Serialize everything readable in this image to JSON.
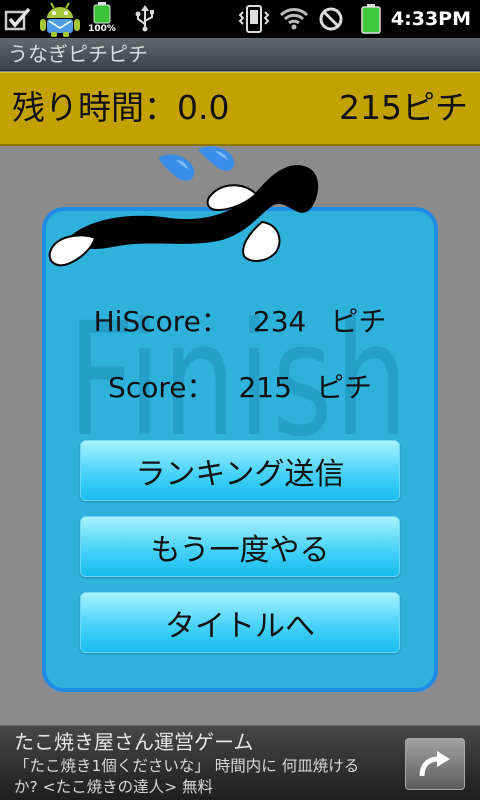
{
  "status_bar": {
    "time": "4:33PM",
    "battery_notification_text": "100%",
    "left_icons": [
      "checkbox-icon",
      "android-icon",
      "battery-full-icon",
      "usb-icon"
    ],
    "right_icons": [
      "vibrate-icon",
      "wifi-icon",
      "no-signal-icon",
      "battery-icon"
    ]
  },
  "app": {
    "title": "うなぎピチピチ"
  },
  "hud": {
    "time_label": "残り時間：",
    "time_value": "0.0",
    "score_value": "215",
    "score_unit": "ピチ"
  },
  "result": {
    "watermark": "Finish",
    "hiscore_label": "HiScore：",
    "hiscore_value": "234",
    "score_label": "Score：",
    "score_value": "215",
    "unit": "ピチ",
    "decoration_icons": [
      "eel-icon",
      "water-drop-icon"
    ]
  },
  "buttons": [
    {
      "label": "ランキング送信"
    },
    {
      "label": "もう一度やる"
    },
    {
      "label": "タイトルへ"
    }
  ],
  "ad": {
    "title": "たこ焼き屋さん運営ゲーム",
    "line1": "「たこ焼き1個くださいな」 時間内に 何皿焼ける",
    "line2": "か? <たこ焼きの達人> 無料",
    "action_icon": "arrow-icon"
  },
  "colors": {
    "background": "#8b8b8b",
    "hud_bg": "#c3a200",
    "dialog_fill": "#2eb2dc",
    "dialog_border": "#1f8ce8",
    "button_top": "#a8f2ff",
    "button_bottom": "#17bdef",
    "eel": "#000000",
    "droplet": "#3a8de8"
  }
}
